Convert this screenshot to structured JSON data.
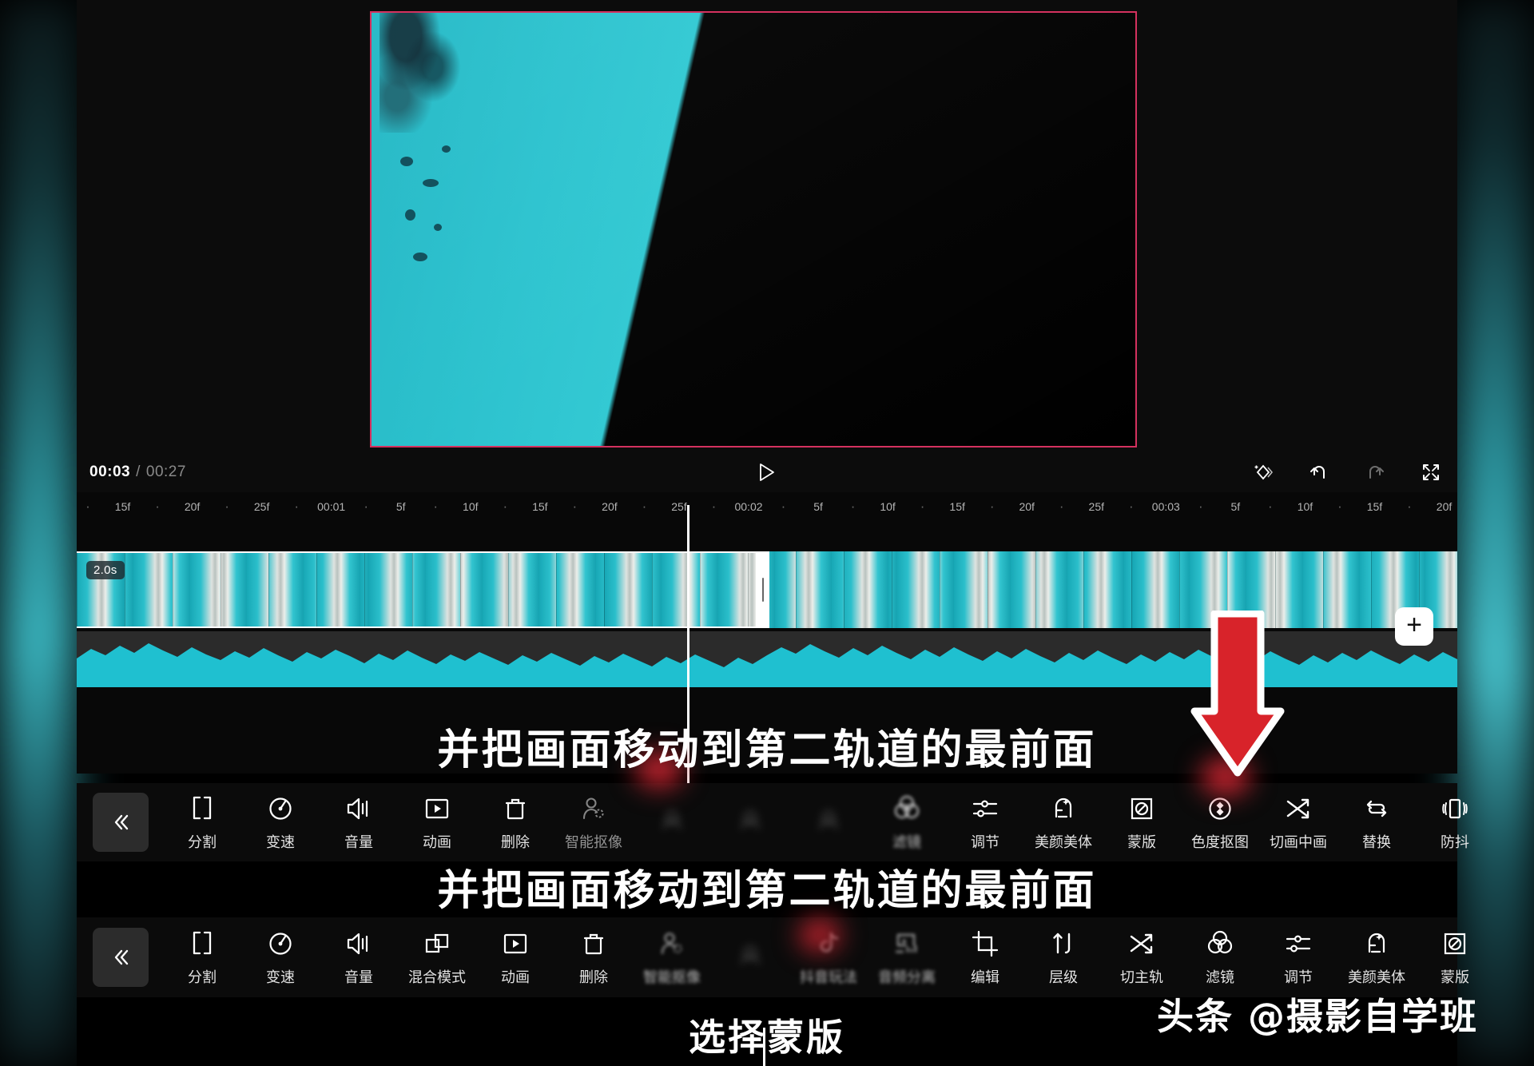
{
  "app": {
    "name": "video-editor"
  },
  "player": {
    "current_time": "00:03",
    "separator": "/",
    "total_time": "00:27",
    "play_icon": "play-triangle-icon",
    "right_icons": [
      {
        "name": "keyframe-icon",
        "label": "关键帧"
      },
      {
        "name": "undo-icon",
        "label": "撤销"
      },
      {
        "name": "redo-icon",
        "label": "重做"
      },
      {
        "name": "fullscreen-icon",
        "label": "全屏"
      }
    ]
  },
  "timeline": {
    "ruler_ticks": [
      "·",
      "15f",
      "·",
      "20f",
      "·",
      "25f",
      "·",
      "00:01",
      "·",
      "5f",
      "·",
      "10f",
      "·",
      "15f",
      "·",
      "20f",
      "·",
      "25f",
      "·",
      "00:02",
      "·",
      "5f",
      "·",
      "10f",
      "·",
      "15f",
      "·",
      "20f",
      "·",
      "25f",
      "·",
      "00:03",
      "·",
      "5f",
      "·",
      "10f",
      "·",
      "15f",
      "·",
      "20f"
    ],
    "clip_duration_badge": "2.0s",
    "add_track_label": "+",
    "playhead_time": "00:02"
  },
  "toolbar_primary": {
    "collapse_label": "«",
    "items": [
      {
        "name": "split",
        "label": "分割",
        "icon": "split-icon",
        "state": "normal"
      },
      {
        "name": "speed",
        "label": "变速",
        "icon": "speed-icon",
        "state": "normal"
      },
      {
        "name": "volume",
        "label": "音量",
        "icon": "volume-icon",
        "state": "normal"
      },
      {
        "name": "animation",
        "label": "动画",
        "icon": "animation-icon",
        "state": "normal"
      },
      {
        "name": "delete",
        "label": "删除",
        "icon": "trash-icon",
        "state": "normal"
      },
      {
        "name": "smart-cutout",
        "label": "智能抠像",
        "icon": "person-cutout-icon",
        "state": "dim"
      },
      {
        "name": "obscured-1",
        "label": "",
        "icon": "unknown-icon",
        "state": "blurred"
      },
      {
        "name": "obscured-2",
        "label": "",
        "icon": "unknown-icon",
        "state": "blurred"
      },
      {
        "name": "obscured-3",
        "label": "",
        "icon": "unknown-icon",
        "state": "blurred"
      },
      {
        "name": "filter",
        "label": "滤镜",
        "icon": "filter-circles-icon",
        "state": "soft"
      },
      {
        "name": "adjust",
        "label": "调节",
        "icon": "sliders-icon",
        "state": "normal"
      },
      {
        "name": "beauty",
        "label": "美颜美体",
        "icon": "beauty-face-icon",
        "state": "normal"
      },
      {
        "name": "mask",
        "label": "蒙版",
        "icon": "mask-icon",
        "state": "normal"
      },
      {
        "name": "chroma-key",
        "label": "色度抠图",
        "icon": "chroma-key-icon",
        "state": "normal"
      },
      {
        "name": "cut-to-pip",
        "label": "切画中画",
        "icon": "shuffle-icon",
        "state": "normal"
      },
      {
        "name": "replace",
        "label": "替换",
        "icon": "replace-loop-icon",
        "state": "normal"
      },
      {
        "name": "stabilize",
        "label": "防抖",
        "icon": "stabilize-icon",
        "state": "normal"
      }
    ]
  },
  "toolbar_secondary": {
    "collapse_label": "«",
    "items": [
      {
        "name": "split",
        "label": "分割",
        "icon": "split-icon",
        "state": "normal"
      },
      {
        "name": "speed",
        "label": "变速",
        "icon": "speed-icon",
        "state": "normal"
      },
      {
        "name": "volume",
        "label": "音量",
        "icon": "volume-icon",
        "state": "normal"
      },
      {
        "name": "blend-mode",
        "label": "混合模式",
        "icon": "blend-squares-icon",
        "state": "normal"
      },
      {
        "name": "animation",
        "label": "动画",
        "icon": "animation-icon",
        "state": "normal"
      },
      {
        "name": "delete",
        "label": "删除",
        "icon": "trash-icon",
        "state": "normal"
      },
      {
        "name": "smart-cutout",
        "label": "智能抠像",
        "icon": "person-cutout-icon",
        "state": "soft"
      },
      {
        "name": "obscured-1",
        "label": "",
        "icon": "unknown-icon",
        "state": "blurred"
      },
      {
        "name": "douyin-effects",
        "label": "抖音玩法",
        "icon": "douyin-icon",
        "state": "soft"
      },
      {
        "name": "audio-separate",
        "label": "音频分离",
        "icon": "audio-split-icon",
        "state": "soft"
      },
      {
        "name": "edit",
        "label": "编辑",
        "icon": "crop-icon",
        "state": "normal"
      },
      {
        "name": "layer",
        "label": "层级",
        "icon": "layer-arrows-icon",
        "state": "normal"
      },
      {
        "name": "cut-to-main",
        "label": "切主轨",
        "icon": "shuffle-icon",
        "state": "normal"
      },
      {
        "name": "filter",
        "label": "滤镜",
        "icon": "filter-circles-icon",
        "state": "normal"
      },
      {
        "name": "adjust",
        "label": "调节",
        "icon": "sliders-icon",
        "state": "normal"
      },
      {
        "name": "beauty",
        "label": "美颜美体",
        "icon": "beauty-face-icon",
        "state": "normal"
      },
      {
        "name": "mask",
        "label": "蒙版",
        "icon": "mask-icon",
        "state": "normal"
      }
    ]
  },
  "captions": {
    "line1": "并把画面移动到第二轨道的最前面",
    "line2": "并把画面移动到第二轨道的最前面",
    "line3": "选择蒙版"
  },
  "watermark": {
    "text": "头条 @摄影自学班"
  },
  "colors": {
    "accent_teal": "#2bbfcb",
    "selection_red": "#d4315f",
    "arrow_red": "#d8232a",
    "background": "#000000",
    "toolbar_bg": "#0b0b0b",
    "text_primary": "#ffffff",
    "text_secondary": "#8a8a8a"
  }
}
